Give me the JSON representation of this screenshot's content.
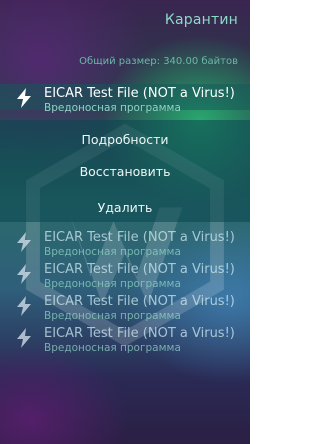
{
  "header": {
    "title": "Карантин",
    "total_size": "Общий размер: 340.00 байтов"
  },
  "selected_item": {
    "icon": "bolt-icon",
    "title": "EICAR Test File (NOT a Virus!)",
    "subtitle": "Вредоносная программа"
  },
  "context_menu": {
    "details": "Подробности",
    "restore": "Восстановить",
    "delete": "Удалить"
  },
  "items": [
    {
      "icon": "bolt-icon",
      "title": "EICAR Test File (NOT a Virus!)",
      "subtitle": "Вредоносная программа"
    },
    {
      "icon": "bolt-icon",
      "title": "EICAR Test File (NOT a Virus!)",
      "subtitle": "Вредоносная программа"
    },
    {
      "icon": "bolt-icon",
      "title": "EICAR Test File (NOT a Virus!)",
      "subtitle": "Вредоносная программа"
    },
    {
      "icon": "bolt-icon",
      "title": "EICAR Test File (NOT a Virus!)",
      "subtitle": "Вредоносная программа"
    }
  ],
  "colors": {
    "accent": "#8ed8c8",
    "text": "#ffffff"
  }
}
